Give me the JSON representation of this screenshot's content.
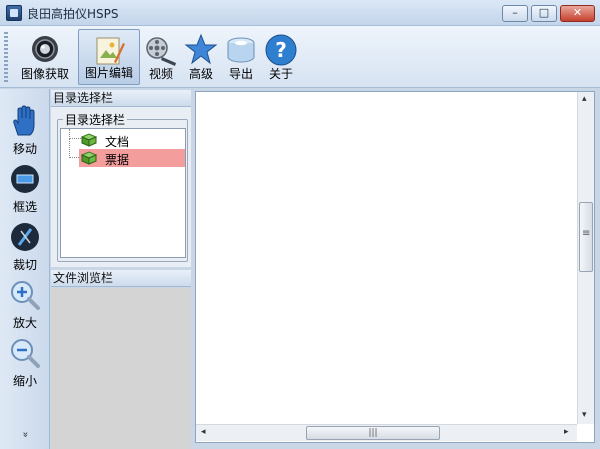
{
  "window": {
    "title": "良田高拍仪HSPS",
    "minimize_glyph": "–",
    "maximize_glyph": "□",
    "close_glyph": "✕"
  },
  "toolbar": {
    "items": [
      {
        "label": "图像获取",
        "icon": "camera-icon",
        "active": false
      },
      {
        "label": "图片编辑",
        "icon": "image-edit-icon",
        "active": true
      },
      {
        "label": "视频",
        "icon": "film-reel-icon",
        "active": false
      },
      {
        "label": "高级",
        "icon": "star-icon",
        "active": false
      },
      {
        "label": "导出",
        "icon": "export-disk-icon",
        "active": false
      },
      {
        "label": "关于",
        "icon": "help-question-icon",
        "active": false
      }
    ]
  },
  "left_tools": {
    "items": [
      {
        "label": "移动",
        "icon": "hand-icon"
      },
      {
        "label": "框选",
        "icon": "select-box-icon"
      },
      {
        "label": "裁切",
        "icon": "crop-icon"
      },
      {
        "label": "放大",
        "icon": "zoom-in-icon"
      },
      {
        "label": "缩小",
        "icon": "zoom-out-icon"
      }
    ],
    "more_glyph": "»"
  },
  "directory_panel": {
    "header": "目录选择栏",
    "group_label": "目录选择栏",
    "tree_items": [
      {
        "label": "文档",
        "selected": false,
        "icon": "book-icon"
      },
      {
        "label": "票据",
        "selected": true,
        "icon": "book-icon"
      }
    ]
  },
  "browse_panel": {
    "header": "文件浏览栏"
  },
  "main_view": {
    "hscroll_thumb_glyph": "|||",
    "left_arrow": "◂",
    "right_arrow": "▸",
    "up_arrow": "▴",
    "down_arrow": "▾"
  },
  "colors": {
    "selection": "#f39d9d",
    "titlebar": "#c3d5ea",
    "browse_bg": "#d4d4d4"
  }
}
